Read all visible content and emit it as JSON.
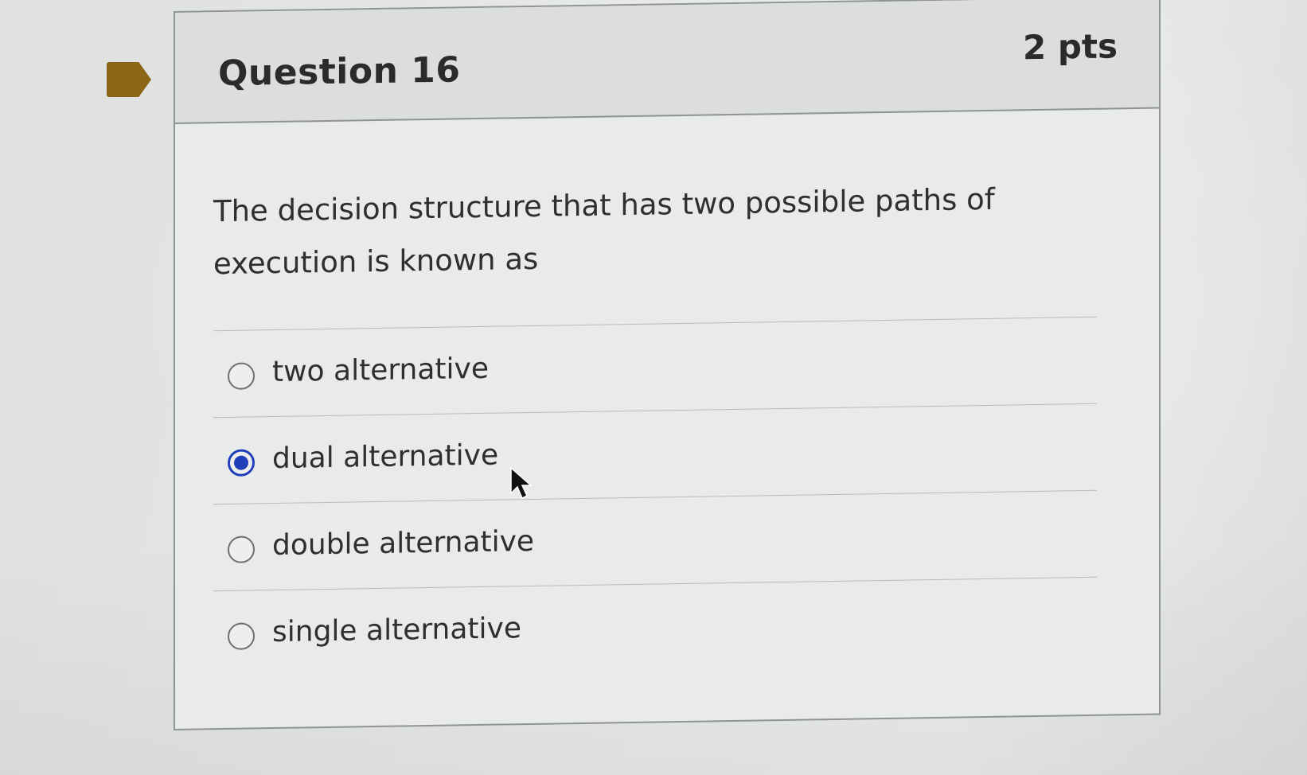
{
  "question": {
    "title": "Question 16",
    "points": "2 pts",
    "text": "The decision structure that has two possible paths of execution is known as"
  },
  "answers": [
    {
      "label": "two alternative",
      "selected": false
    },
    {
      "label": "dual alternative",
      "selected": true
    },
    {
      "label": "double alternative",
      "selected": false
    },
    {
      "label": "single alternative",
      "selected": false
    }
  ],
  "colors": {
    "flag": "#8a6616",
    "selected_radio": "#1f3fb8",
    "card_border": "#8e9396"
  },
  "icons": {
    "flag": "bookmark-flag-icon",
    "cursor": "mouse-pointer-icon"
  }
}
